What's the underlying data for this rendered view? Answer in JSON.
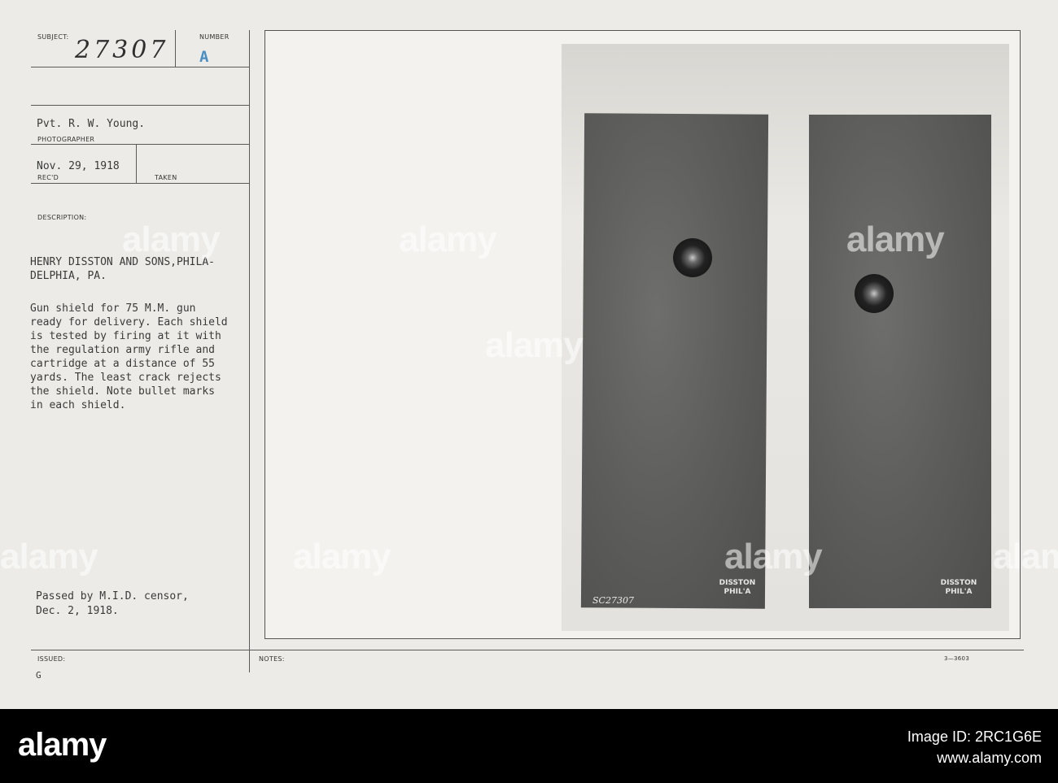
{
  "card": {
    "subject_label": "SUBJECT:",
    "subject_value": "27307",
    "number_label": "NUMBER",
    "number_value": "A",
    "photographer_value": "Pvt. R. W. Young.",
    "photographer_label": "PHOTOGRAPHER",
    "recd_value": "Nov. 29, 1918",
    "recd_label": "REC'D",
    "taken_label": "TAKEN",
    "description_label": "DESCRIPTION:",
    "description_lines": [
      "HENRY DISSTON AND SONS,PHILA-",
      "DELPHIA, PA.",
      "",
      "Gun shield for 75 M.M. gun",
      "ready for delivery. Each shield",
      "is tested by firing at it with",
      "the regulation army rifle and",
      "cartridge at a distance of 55",
      "yards. The least crack rejects",
      "the shield. Note bullet marks",
      "in each shield."
    ],
    "censor_lines": [
      "Passed by M.I.D. censor,",
      "Dec. 2, 1918."
    ],
    "issued_label": "ISSUED:",
    "issued_value": "G",
    "notes_label": "NOTES:",
    "form_number": "3—3603"
  },
  "photo": {
    "left_stamp": [
      "DISSTON",
      "PHIL'A"
    ],
    "right_stamp": [
      "DISSTON",
      "PHIL'A"
    ],
    "negative_number": "SC27307"
  },
  "watermark": {
    "text": "alamy"
  },
  "footer": {
    "logo": "alamy",
    "line1": "Image ID: 2RC1G6E",
    "line2": "www.alamy.com"
  },
  "colors": {
    "card_bg": "#ecebe7",
    "footer_bg": "#000000",
    "number_stamp": "#4a8fc4"
  }
}
